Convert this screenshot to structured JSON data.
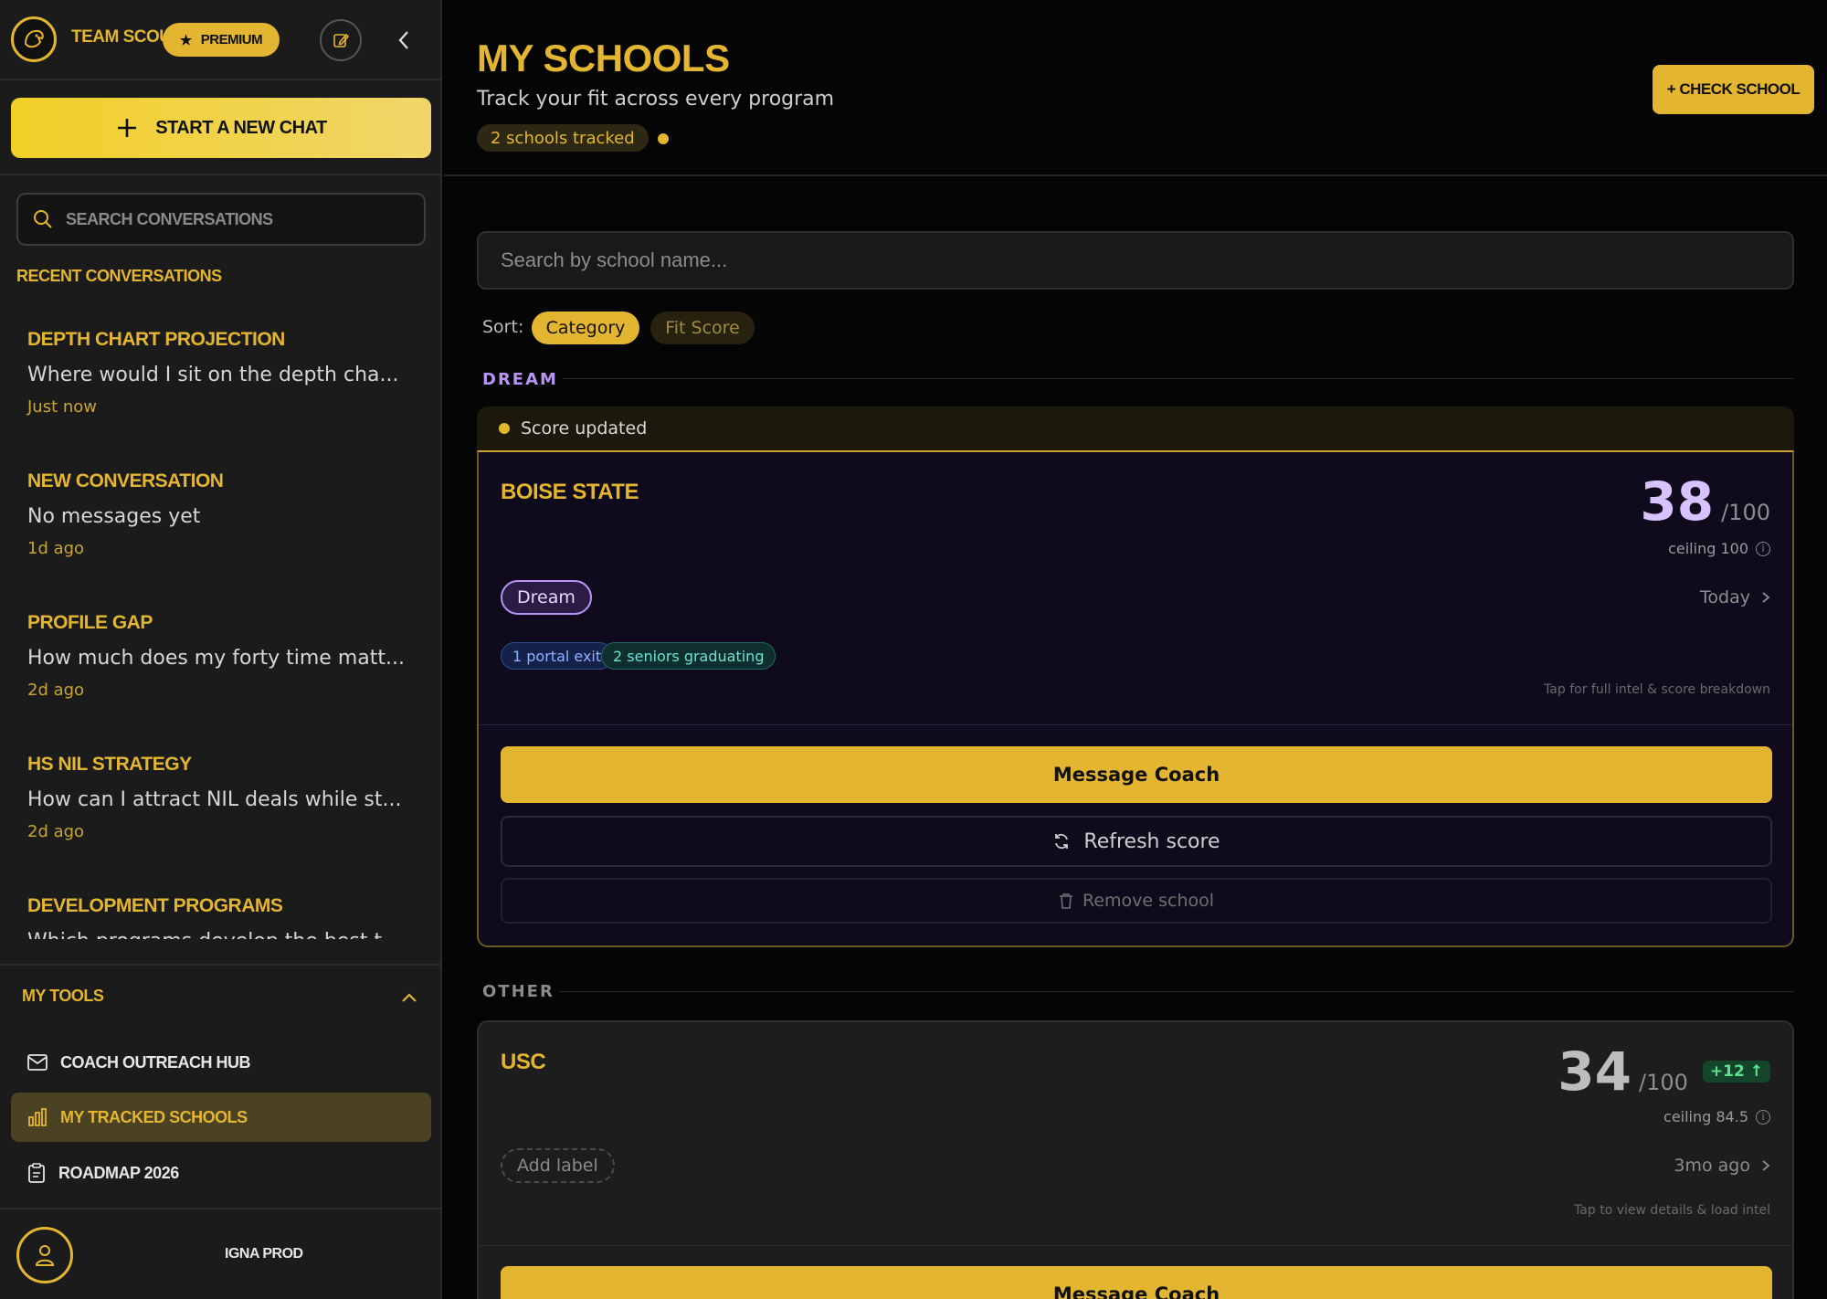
{
  "sidebar": {
    "team_name": "TEAM SCOUT",
    "premium_label": "PREMIUM",
    "new_chat_label": "START A NEW CHAT",
    "search_placeholder": "SEARCH CONVERSATIONS",
    "recent_title": "RECENT CONVERSATIONS",
    "conversations": [
      {
        "title": "DEPTH CHART PROJECTION",
        "preview": "Where would I sit on the depth cha...",
        "time": "Just now"
      },
      {
        "title": "NEW CONVERSATION",
        "preview": "No messages yet",
        "time": "1d ago"
      },
      {
        "title": "PROFILE GAP",
        "preview": "How much does my forty time matt...",
        "time": "2d ago"
      },
      {
        "title": "HS NIL STRATEGY",
        "preview": "How can I attract NIL deals while st...",
        "time": "2d ago"
      },
      {
        "title": "DEVELOPMENT PROGRAMS",
        "preview": "Which programs develop the best t...",
        "time": ""
      }
    ],
    "tools_title": "MY TOOLS",
    "tools": [
      {
        "label": "COACH OUTREACH HUB",
        "icon": "mail-icon"
      },
      {
        "label": "MY TRACKED SCHOOLS",
        "icon": "bar-chart-icon",
        "active": true
      },
      {
        "label": "ROADMAP 2026",
        "icon": "clipboard-icon"
      }
    ],
    "user_name": "IGNA PROD"
  },
  "main": {
    "title": "MY SCHOOLS",
    "subtitle": "Track your fit across every program",
    "tracked_label": "2 schools tracked",
    "check_school_label": "+ CHECK SCHOOL",
    "search_placeholder": "Search by school name...",
    "sort_label": "Sort:",
    "sort_options": [
      "Category",
      "Fit Score"
    ],
    "sort_selected": "Category",
    "groups": [
      {
        "name": "DREAM",
        "color": "#b794f4",
        "banner": "Score updated",
        "school": {
          "name": "BOISE STATE",
          "score": "38",
          "score_max": "/100",
          "ceiling": "ceiling 100",
          "label": "Dream",
          "when": "Today",
          "intel": [
            "1 portal exit",
            "2 seniors graduating"
          ],
          "hint": "Tap for full intel & score breakdown",
          "message_label": "Message Coach",
          "refresh_label": "Refresh score",
          "remove_label": "Remove school"
        }
      },
      {
        "name": "OTHER",
        "color": "#8a8a8a",
        "school": {
          "name": "USC",
          "score": "34",
          "score_max": "/100",
          "delta": "+12",
          "ceiling": "ceiling 84.5",
          "label": "Add label",
          "when": "3mo ago",
          "hint": "Tap to view details & load intel",
          "message_label": "Message Coach"
        }
      }
    ]
  },
  "colors": {
    "accent": "#e3b531",
    "dream": "#b794f4",
    "positive": "#5fe08c"
  }
}
